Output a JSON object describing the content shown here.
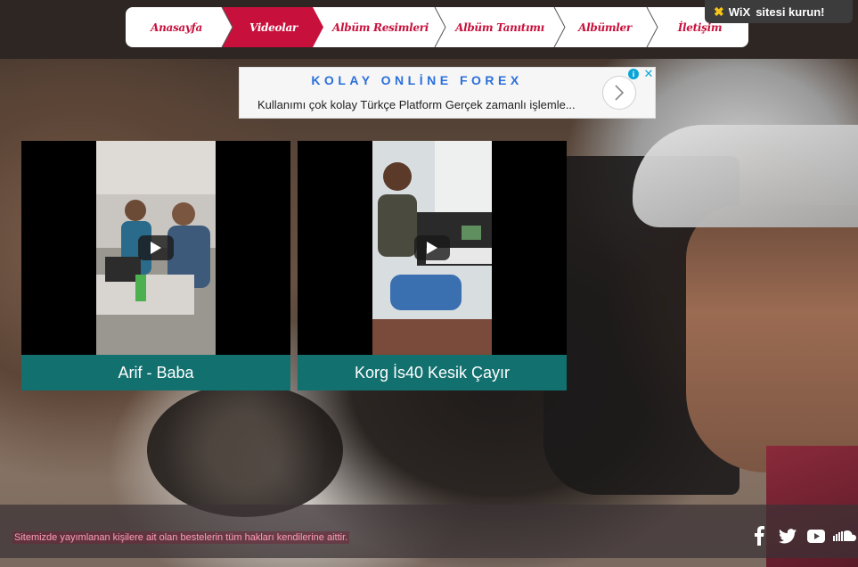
{
  "nav": {
    "items": [
      {
        "label": "Anasayfa",
        "active": false
      },
      {
        "label": "Videolar",
        "active": true
      },
      {
        "label": "Albüm Resimleri",
        "active": false
      },
      {
        "label": "Albüm Tanıtımı",
        "active": false
      },
      {
        "label": "Albümler",
        "active": false
      },
      {
        "label": "İletişim",
        "active": false
      }
    ]
  },
  "wix_banner": {
    "brand": "WiX",
    "text": "sitesi kurun!"
  },
  "ad": {
    "title": "KOLAY ONLİNE FOREX",
    "text": "Kullanımı çok kolay Türkçe Platform Gerçek zamanlı işlemle..."
  },
  "videos": [
    {
      "title": "Arif - Baba"
    },
    {
      "title": "Korg İs40 Kesik Çayır"
    }
  ],
  "footer": {
    "copyright": "Sitemizde yayımlanan kişilere ait olan bestelerin tüm hakları kendilerine aittir.",
    "social_icons": [
      "facebook-icon",
      "twitter-icon",
      "youtube-icon",
      "soundcloud-icon"
    ]
  },
  "colors": {
    "nav_accent": "#c8103c",
    "caption_bg": "#12706f",
    "ad_title": "#2a6fdb"
  }
}
